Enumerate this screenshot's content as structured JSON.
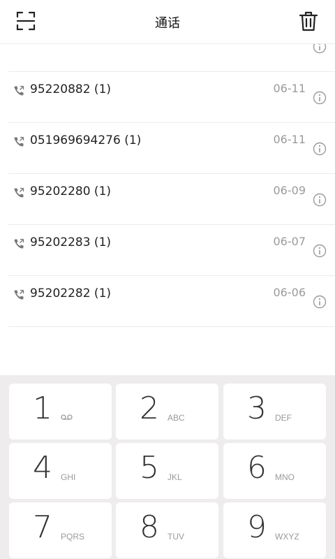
{
  "header": {
    "title": "通话"
  },
  "calls": [
    {
      "number": "95220882 (1)",
      "date": "06-11"
    },
    {
      "number": "051969694276 (1)",
      "date": "06-11"
    },
    {
      "number": "95202280 (1)",
      "date": "06-09"
    },
    {
      "number": "95202283 (1)",
      "date": "06-07"
    },
    {
      "number": "95202282 (1)",
      "date": "06-06"
    }
  ],
  "keypad": [
    {
      "digit": "1",
      "letters": ""
    },
    {
      "digit": "2",
      "letters": "ABC"
    },
    {
      "digit": "3",
      "letters": "DEF"
    },
    {
      "digit": "4",
      "letters": "GHI"
    },
    {
      "digit": "5",
      "letters": "JKL"
    },
    {
      "digit": "6",
      "letters": "MNO"
    },
    {
      "digit": "7",
      "letters": "PQRS"
    },
    {
      "digit": "8",
      "letters": "TUV"
    },
    {
      "digit": "9",
      "letters": "WXYZ"
    }
  ],
  "colors": {
    "keypad_bg": "#efecee",
    "secondary_text": "#9a9a9a"
  },
  "icons": [
    "scan-icon",
    "trash-icon",
    "call-icon",
    "info-icon",
    "voicemail-icon"
  ]
}
